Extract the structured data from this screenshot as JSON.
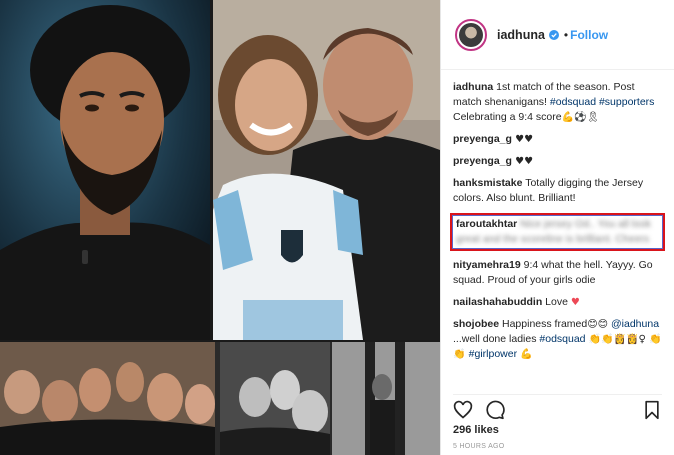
{
  "post": {
    "author": "iadhuna",
    "follow_label": "Follow",
    "dot": "•",
    "likes": "296 likes",
    "time": "5 HOURS AGO"
  },
  "comments": [
    {
      "user": "iadhuna",
      "parts": [
        {
          "t": "text",
          "v": " 1st match of the season. Post match shenanigans! "
        },
        {
          "t": "tag",
          "v": "#odsquad"
        },
        {
          "t": "text",
          "v": " "
        },
        {
          "t": "tag",
          "v": "#supporters"
        },
        {
          "t": "text",
          "v": " Celebrating a 9:4 score"
        },
        {
          "t": "emoji",
          "v": "💪⚽🎗"
        }
      ]
    },
    {
      "user": "preyenga_g",
      "parts": [
        {
          "t": "emoji",
          "v": " ♥♥"
        }
      ]
    },
    {
      "user": "preyenga_g",
      "parts": [
        {
          "t": "emoji",
          "v": " ♥♥"
        }
      ]
    },
    {
      "user": "hanksmistake",
      "parts": [
        {
          "t": "text",
          "v": " Totally digging the Jersey colors. Also blunt. Brilliant!"
        }
      ]
    },
    {
      "user": "faroutakhtar",
      "highlight": true,
      "parts": [
        {
          "t": "blur",
          "v": " Nice jersey Od.. You all look great and the scoreline is brilliant. Cheers"
        }
      ]
    },
    {
      "user": "nityamehra19",
      "parts": [
        {
          "t": "text",
          "v": " 9:4 what the hell. Yayyy. Go squad. Proud of your girls odie"
        }
      ]
    },
    {
      "user": "nailashahabuddin",
      "parts": [
        {
          "t": "text",
          "v": " Love "
        },
        {
          "t": "heart",
          "v": "♥"
        }
      ]
    },
    {
      "user": "shojobee",
      "parts": [
        {
          "t": "text",
          "v": " Happiness framed"
        },
        {
          "t": "emoji",
          "v": "😊😊"
        },
        {
          "t": "text",
          "v": " "
        },
        {
          "t": "tag",
          "v": "@iadhuna"
        },
        {
          "t": "text",
          "v": " ...well done ladies "
        },
        {
          "t": "tag",
          "v": "#odsquad"
        },
        {
          "t": "emoji",
          "v": " 👏👏👸👸♀ 👏👏 "
        },
        {
          "t": "tag",
          "v": "#girlpower"
        },
        {
          "t": "emoji",
          "v": " 💪"
        }
      ]
    }
  ],
  "icons": {
    "like": "heart-outline-icon",
    "comment": "comment-bubble-icon",
    "save": "bookmark-icon",
    "verified": "verified-badge-icon"
  },
  "colors": {
    "follow": "#3897f0",
    "highlight_border": "#d9141b",
    "heart": "#ed4956"
  }
}
